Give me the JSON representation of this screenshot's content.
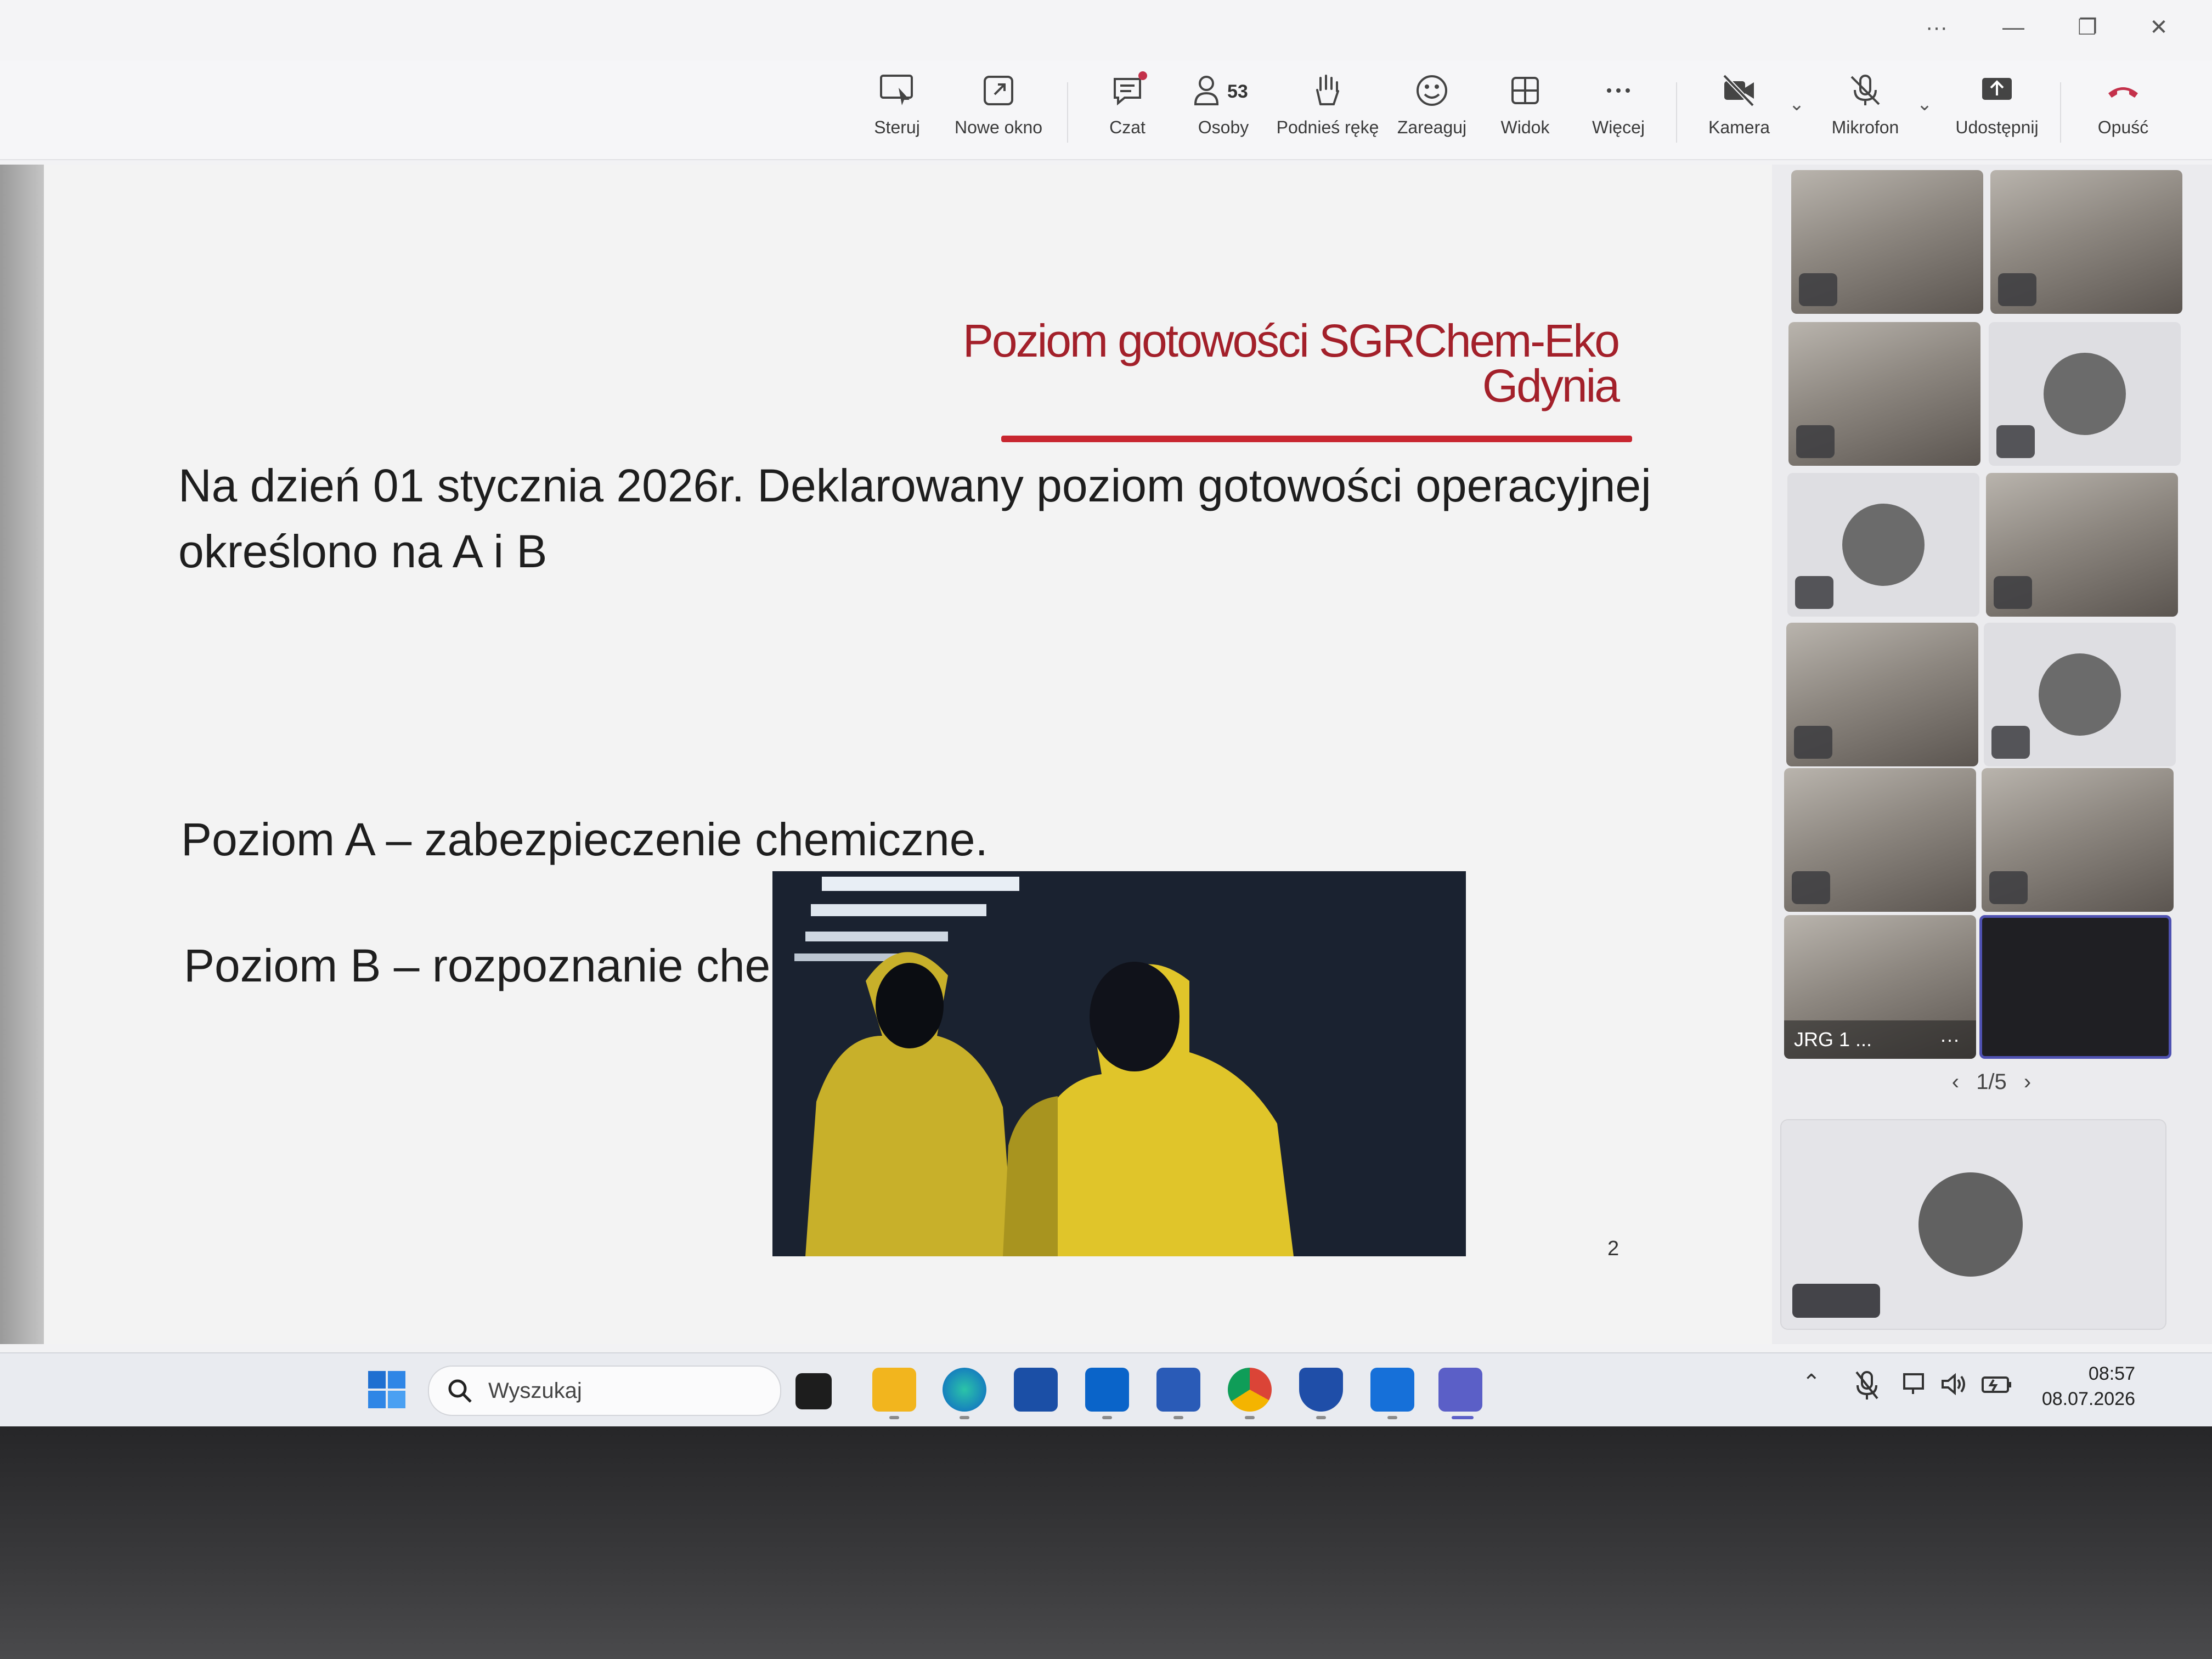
{
  "toolbar": {
    "items": [
      {
        "label": "Steruj"
      },
      {
        "label": "Nowe okno"
      },
      {
        "label": "Czat"
      },
      {
        "label": "Osoby",
        "count": "53"
      },
      {
        "label": "Podnieś rękę"
      },
      {
        "label": "Zareaguj"
      },
      {
        "label": "Widok"
      },
      {
        "label": "Więcej"
      },
      {
        "label": "Kamera"
      },
      {
        "label": "Mikrofon"
      },
      {
        "label": "Udostępnij"
      },
      {
        "label": "Opuść"
      }
    ],
    "leave_color": "#c4314b"
  },
  "window_controls": {
    "more": "···",
    "minimize": "—",
    "restore": "❐",
    "close": "✕"
  },
  "slide": {
    "title_line1": "Poziom gotowości SGRChem-Eko",
    "title_line2": "Gdynia",
    "paragraph1_line1": "Na dzień 01 stycznia 2026r. Deklarowany poziom gotowości operacyjnej",
    "paragraph1_line2": "określono na A i B",
    "level_a": "Poziom A – zabezpieczenie chemiczne.",
    "level_b": "Poziom B – rozpoznanie chemiczne.",
    "page_number": "2",
    "title_color": "#a3202a"
  },
  "participants": {
    "named_tile": "JRG 1 ...",
    "more": "···",
    "pager": "1/5",
    "prev": "‹",
    "next": "›"
  },
  "taskbar": {
    "search_placeholder": "Wyszukaj",
    "time": "08:57",
    "date": "08.07.2026",
    "apps": [
      "start-icon",
      "search-icon",
      "task-view-icon",
      "file-explorer-icon",
      "edge-icon",
      "store-icon",
      "outlook-icon",
      "word-icon",
      "chrome-icon",
      "defender-icon",
      "outlook-new-icon",
      "teams-icon"
    ]
  }
}
